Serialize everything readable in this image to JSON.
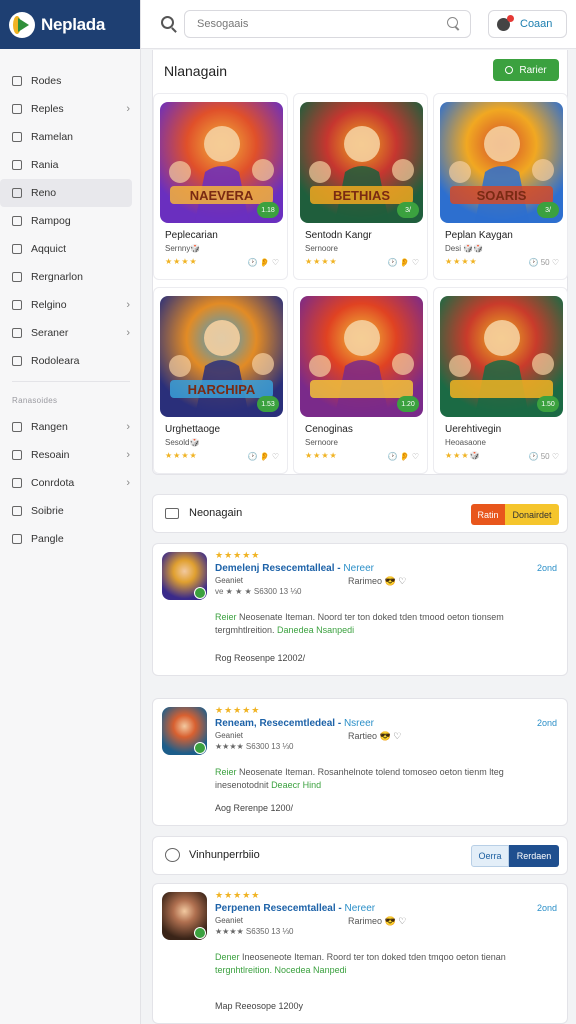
{
  "brand": {
    "name": "Neplada"
  },
  "topbar": {
    "search_placeholder": "Sesogaais",
    "profile_label": "Coaan"
  },
  "sidebar": {
    "items": [
      {
        "label": "Rodes",
        "chevron": false
      },
      {
        "label": "Reples",
        "chevron": true
      },
      {
        "label": "Ramelan",
        "chevron": false
      },
      {
        "label": "Rania",
        "chevron": false
      },
      {
        "label": "Reno",
        "chevron": false,
        "active": true
      },
      {
        "label": "Rampog",
        "chevron": false
      },
      {
        "label": "Aqquict",
        "chevron": false
      },
      {
        "label": "Rergnarlon",
        "chevron": false
      },
      {
        "label": "Relgino",
        "chevron": true
      },
      {
        "label": "Seraner",
        "chevron": true
      },
      {
        "label": "Rodoleara",
        "chevron": false
      }
    ],
    "heading": "Ranasoides",
    "items2": [
      {
        "label": "Rangen",
        "chevron": true
      },
      {
        "label": "Resoain",
        "chevron": true
      },
      {
        "label": "Conrdota",
        "chevron": true
      },
      {
        "label": "Soibrie",
        "chevron": false
      },
      {
        "label": "Pangle",
        "chevron": false
      }
    ]
  },
  "games_section": {
    "title": "Nlanagain",
    "button_label": "Rarier",
    "games": [
      {
        "title": "Peplecarian",
        "subtitle": "Sernny🎲",
        "stars": "★★★★",
        "meta": "🕑 👂 ♡",
        "badge": "1.18",
        "art_text": "NAEVERA"
      },
      {
        "title": "Sentodn Kangr",
        "subtitle": "Sernoore",
        "stars": "★★★★",
        "meta": "🕑 👂 ♡",
        "badge": "3/",
        "art_text": "BETHIAS"
      },
      {
        "title": "Peplan Kaygan",
        "subtitle": "Desi 🎲🎲",
        "stars": "★★★★",
        "meta": "🕑 50 ♡",
        "badge": "3/",
        "art_text": "SOARIS"
      },
      {
        "title": "Urghettaoge",
        "subtitle": "Sesold🎲",
        "stars": "★★★★",
        "meta": "🕑 👂 ♡",
        "badge": "1.53",
        "art_text": "HARCHIPA"
      },
      {
        "title": "Cenoginas",
        "subtitle": "Sernoore",
        "stars": "★★★★",
        "meta": "🕑 👂 ♡",
        "badge": "1.20",
        "art_text": ""
      },
      {
        "title": "Uerehtivegin",
        "subtitle": "Heoasaone",
        "stars": "★★★🎲",
        "meta": "🕑 50 ♡",
        "badge": "1.50",
        "art_text": ""
      }
    ]
  },
  "news1": {
    "title": "Neonagain",
    "tab_a": "Ratin",
    "tab_b": "Donairdet"
  },
  "news2": {
    "title": "Vinhunperrbiio",
    "tab_a": "Oerra",
    "tab_b": "Rerdaen"
  },
  "reviews": [
    {
      "stars": "★★★★★",
      "title": "Demelenj Resecemtalleal -",
      "tag": "Nereer",
      "time": "2ond",
      "author": "Geaniet",
      "meta": "ve ★ ★ ★  S6300  13 ⅓0",
      "emoji": "Rarimeo 😎 ♡",
      "body_lead": "Reier",
      "body": "Neosenate Iteman. Noord ter ton doked tden tmood oeton tionsem tergmhtlreition.",
      "body_tail": "Danedea Nsanpedi",
      "footer": "Rog Reosenpe 12002/"
    },
    {
      "stars": "★★★★★",
      "title": "Reneam, Resecemtledeal -",
      "tag": "Nsreer",
      "time": "2ond",
      "author": "Geaniet",
      "meta": "★★★★  S6300  13 ⅓0",
      "emoji": "Rartieo 😎 ♡",
      "body_lead": "Reier",
      "body": "Neosenate Iteman. Rosanhelnote tolend tomoseo oeton tienm lteg inesenotodnit",
      "body_tail": "Deaecr  Hind",
      "footer": "Aog Rerenpe 1200/"
    },
    {
      "stars": "★★★★★",
      "title": "Perpenen Resecemtalleal -",
      "tag": "Nereer",
      "time": "2ond",
      "author": "Geaniet",
      "meta": "★★★★  S6350  13 ⅓0",
      "emoji": "Rarimeo 😎 ♡",
      "body_lead": "Dener",
      "body": "Ineoseneote Iteman. Roord ter ton doked tden tmqoo oeton tienan",
      "body_tail": "tergnhtlreition. Nocedea Nanpedi",
      "footer": "Map Reeosope 1200y"
    }
  ]
}
